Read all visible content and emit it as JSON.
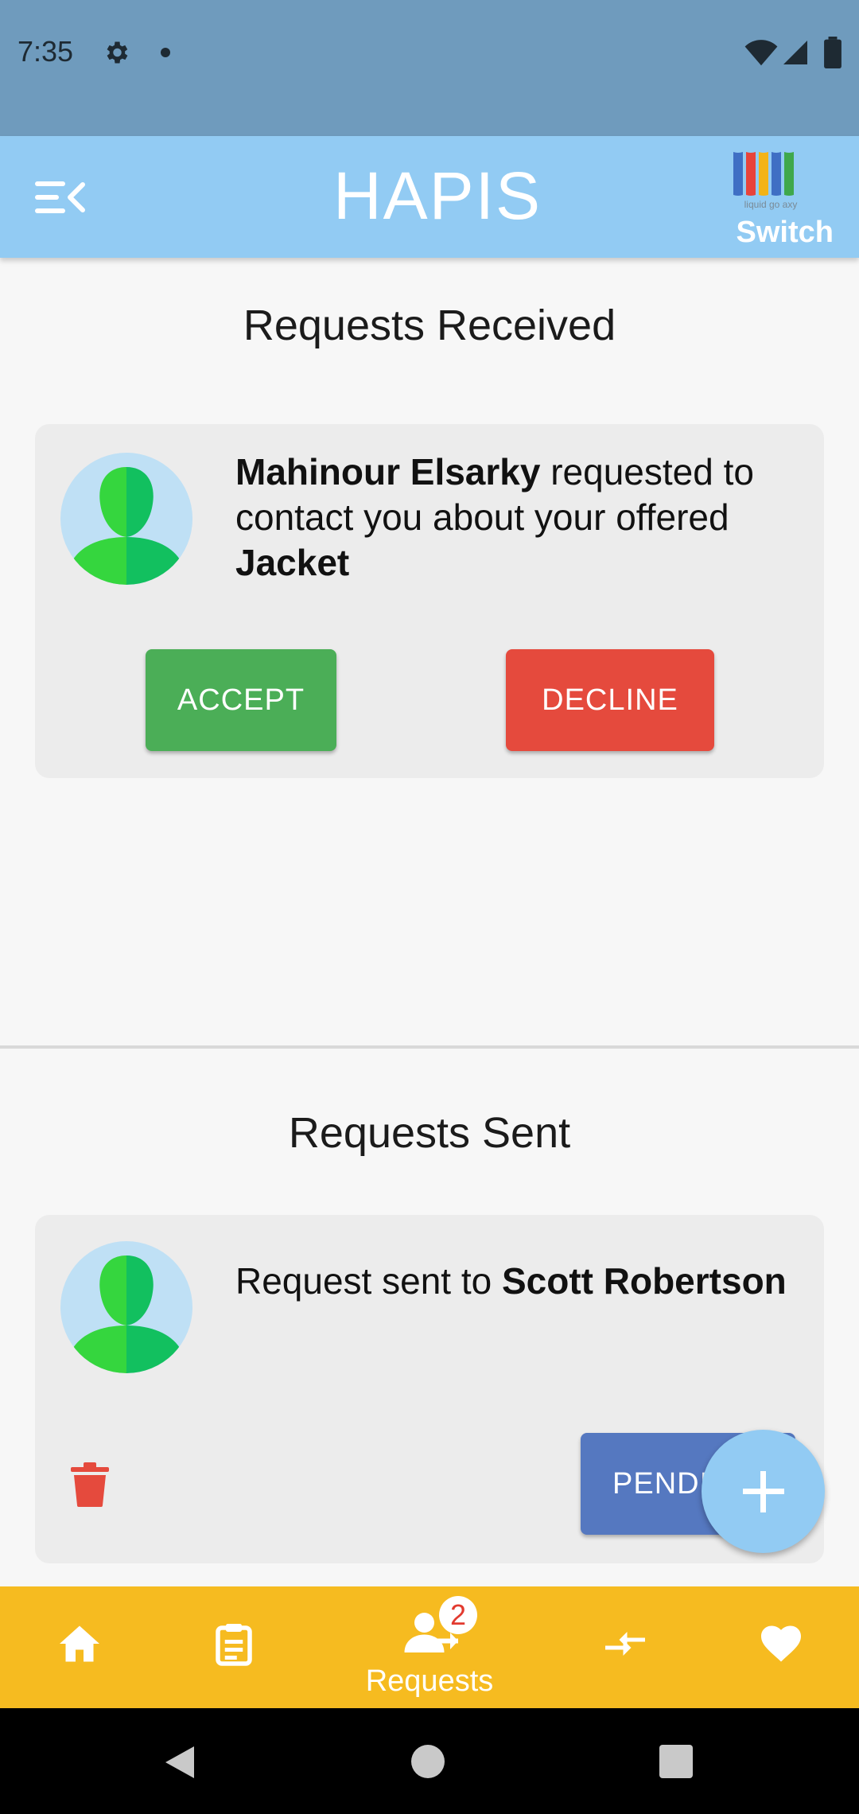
{
  "status_bar": {
    "time": "7:35"
  },
  "app_bar": {
    "title": "HAPIS",
    "switch_label": "Switch",
    "logo_caption": "liquid go axy"
  },
  "received": {
    "title": "Requests Received",
    "request": {
      "name": "Mahinour Elsarky",
      "text_middle": " requested to contact you about your offered ",
      "item": "Jacket",
      "accept_label": "ACCEPT",
      "decline_label": "DECLINE"
    }
  },
  "sent": {
    "title": "Requests Sent",
    "request": {
      "prefix": "Request sent to ",
      "name": "Scott Robertson",
      "status_label": "PENDING"
    }
  },
  "bottom_nav": {
    "requests_label": "Requests",
    "requests_badge": "2"
  },
  "colors": {
    "status_bar": "#6f9bbd",
    "app_bar": "#92cbf3",
    "accept": "#4bae57",
    "decline": "#e54a3d",
    "pending": "#5578c0",
    "bottom_nav": "#f6bb20"
  },
  "icons": [
    "menu-icon",
    "gear-icon",
    "wifi-icon",
    "signal-icon",
    "battery-icon",
    "avatar-icon",
    "trash-icon",
    "plus-icon",
    "home-icon",
    "clipboard-icon",
    "person-icon",
    "swap-icon",
    "heart-icon",
    "back-icon",
    "home-circle-icon",
    "recents-icon"
  ]
}
